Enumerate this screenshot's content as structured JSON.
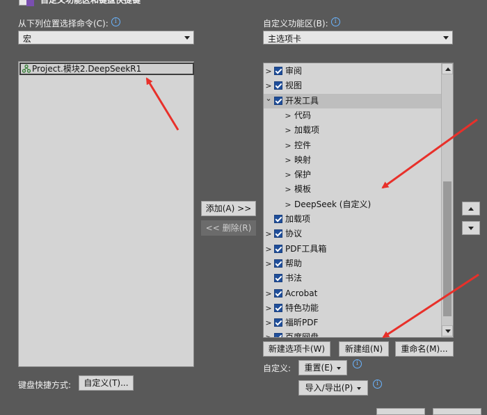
{
  "window": {
    "title_partial": "自定义功能区和键盘快捷键"
  },
  "left": {
    "label": "从下列位置选择命令(C):",
    "combo_value": "宏",
    "items": [
      {
        "label": "Project.模块2.DeepSeekR1"
      }
    ]
  },
  "right": {
    "label": "自定义功能区(B):",
    "combo_value": "主选项卡",
    "tree": [
      {
        "label": "审阅",
        "level": 0,
        "expand": ">",
        "checked": true
      },
      {
        "label": "视图",
        "level": 0,
        "expand": ">",
        "checked": true
      },
      {
        "label": "开发工具",
        "level": 0,
        "expand": "v",
        "checked": true,
        "selected": true
      },
      {
        "label": "代码",
        "level": 1,
        "expand": ">"
      },
      {
        "label": "加载项",
        "level": 1,
        "expand": ">"
      },
      {
        "label": "控件",
        "level": 1,
        "expand": ">"
      },
      {
        "label": "映射",
        "level": 1,
        "expand": ">"
      },
      {
        "label": "保护",
        "level": 1,
        "expand": ">"
      },
      {
        "label": "模板",
        "level": 1,
        "expand": ">"
      },
      {
        "label": "DeepSeek (自定义)",
        "level": 1,
        "expand": ">"
      },
      {
        "label": "加载项",
        "level": 0,
        "expand": "",
        "checked": true
      },
      {
        "label": "协议",
        "level": 0,
        "expand": ">",
        "checked": true
      },
      {
        "label": "PDF工具箱",
        "level": 0,
        "expand": ">",
        "checked": true
      },
      {
        "label": "帮助",
        "level": 0,
        "expand": ">",
        "checked": true
      },
      {
        "label": "书法",
        "level": 0,
        "expand": "",
        "checked": true
      },
      {
        "label": "Acrobat",
        "level": 0,
        "expand": ">",
        "checked": true
      },
      {
        "label": "特色功能",
        "level": 0,
        "expand": ">",
        "checked": true
      },
      {
        "label": "福昕PDF",
        "level": 0,
        "expand": ">",
        "checked": true
      },
      {
        "label": "百度网盘",
        "level": 0,
        "expand": ">",
        "checked": true
      }
    ]
  },
  "middle": {
    "add_label": "添加(A) >>",
    "remove_label": "<< 删除(R)"
  },
  "bottom": {
    "new_tab": "新建选项卡(W)",
    "new_group": "新建组(N)",
    "rename": "重命名(M)...",
    "customize_label": "自定义:",
    "reset": "重置(E)",
    "import_export": "导入/导出(P)"
  },
  "keyboard": {
    "label": "键盘快捷方式:",
    "button": "自定义(T)..."
  },
  "colors": {
    "background": "#595959",
    "checkbox": "#1f4e9a",
    "arrow": "#e8302a"
  }
}
